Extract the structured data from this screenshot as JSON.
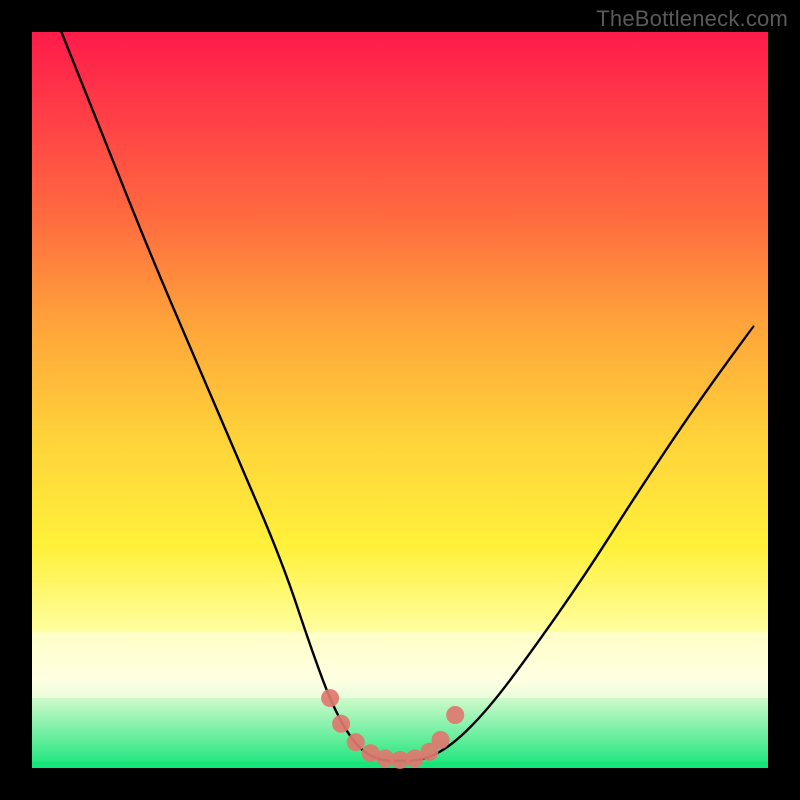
{
  "watermark": "TheBottleneck.com",
  "colors": {
    "frame": "#000000",
    "gradient_top": "#ff1b4a",
    "gradient_mid": "#ffd23a",
    "gradient_bottom": "#16e57a",
    "curve": "#000000",
    "markers": "#e0776f"
  },
  "chart_data": {
    "type": "line",
    "title": "",
    "xlabel": "",
    "ylabel": "",
    "xlim": [
      0,
      100
    ],
    "ylim": [
      0,
      100
    ],
    "series": [
      {
        "name": "bottleneck-curve",
        "x": [
          4,
          10,
          16,
          22,
          28,
          34,
          38,
          41,
          44,
          47,
          50,
          53,
          57,
          62,
          68,
          75,
          82,
          90,
          98
        ],
        "values": [
          100,
          85,
          70,
          56,
          42,
          28,
          16,
          8,
          3,
          1,
          1,
          1,
          3,
          8,
          16,
          26,
          37,
          49,
          60
        ]
      }
    ],
    "markers": {
      "name": "highlight-dots",
      "x": [
        40.5,
        42,
        44,
        46,
        48,
        50,
        52,
        54,
        55.5,
        57.5
      ],
      "values": [
        9.5,
        6,
        3.5,
        2,
        1.3,
        1.1,
        1.3,
        2.2,
        3.8,
        7.2
      ]
    },
    "annotations": []
  }
}
